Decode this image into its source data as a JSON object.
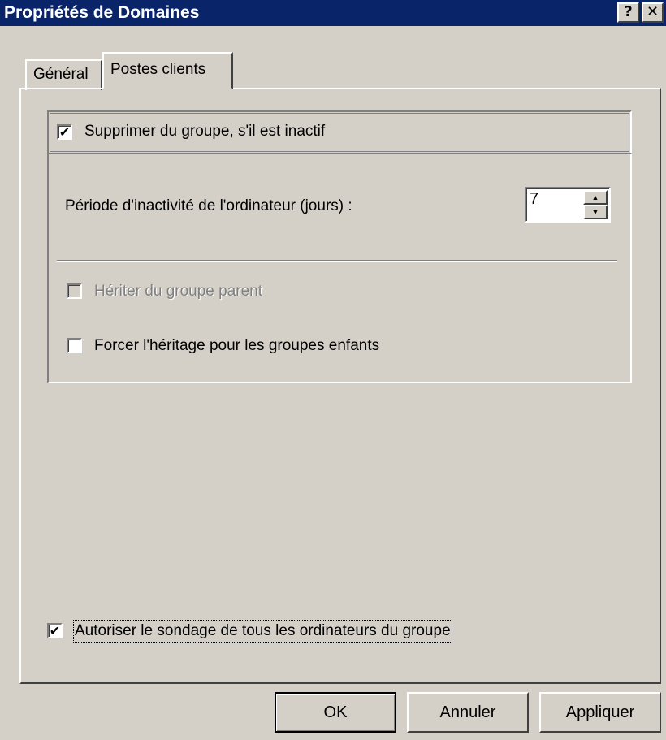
{
  "window": {
    "title": "Propriétés de Domaines",
    "help_label": "?",
    "close_label": "✕"
  },
  "tabs": [
    {
      "label": "Général",
      "active": false
    },
    {
      "label": "Postes clients",
      "active": true
    }
  ],
  "inactivity": {
    "remove_label": "Supprimer du groupe, s'il est inactif",
    "remove_checked": true,
    "period_label": "Période d'inactivité de l'ordinateur (jours) :",
    "period_value": "7",
    "inherit_label": "Hériter du groupe parent",
    "inherit_checked": false,
    "inherit_enabled": false,
    "force_label": "Forcer l'héritage pour les groupes enfants",
    "force_checked": false
  },
  "polling": {
    "label": "Autoriser le sondage de tous les ordinateurs du groupe",
    "checked": true
  },
  "buttons": {
    "ok": "OK",
    "cancel": "Annuler",
    "apply": "Appliquer"
  },
  "glyphs": {
    "check": "✔",
    "spin_up": "▲",
    "spin_down": "▼"
  },
  "colors": {
    "titlebar": "#0a246a",
    "face": "#d4d0c8"
  }
}
